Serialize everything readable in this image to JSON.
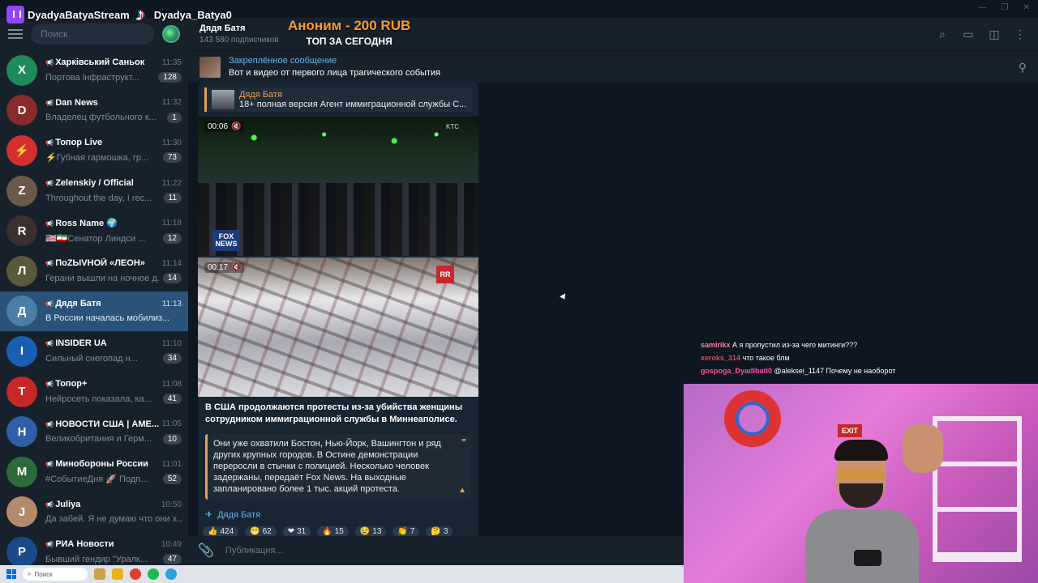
{
  "overlay": {
    "twitch_name": "DyadyaBatyaStream",
    "tiktok_name": "Dyadya_Batya0",
    "donation_line": "Аноним - 200 RUB",
    "donation_sub": "ТОП ЗА СЕГОДНЯ"
  },
  "sidebar": {
    "search_placeholder": "Поиск",
    "chats": [
      {
        "title": "Харківський Саньок",
        "time": "11:35",
        "preview": "Портова інфраструкт...",
        "badge": "128",
        "color": "#1f8a5a",
        "initial": "Х"
      },
      {
        "title": "Dan News",
        "time": "11:32",
        "preview": "Владелец футбольного к...",
        "badge": "1",
        "color": "#8a2b2b",
        "initial": "D"
      },
      {
        "title": "Топор Live",
        "time": "11:30",
        "preview": "⚡Губная гармошка, гр...",
        "badge": "73",
        "color": "#d32f2f",
        "initial": "⚡"
      },
      {
        "title": "Zelenskiy / Official",
        "time": "11:22",
        "preview": "Throughout the day, I rec...",
        "badge": "11",
        "color": "#6b5a4a",
        "initial": "Z"
      },
      {
        "title": "Ross Name 🌍",
        "time": "11:18",
        "preview": "🇺🇸🇮🇷Сенатор Линдси ...",
        "badge": "12",
        "color": "#3b3030",
        "initial": "R"
      },
      {
        "title": "ПоZЫVНОЙ «ЛЕОН»",
        "time": "11:14",
        "preview": "Герани вышли на ночное д...",
        "badge": "14",
        "color": "#5a5a3a",
        "initial": "Л"
      },
      {
        "title": "Дядя Батя",
        "time": "11:13",
        "preview": "В России началась мобилиз...",
        "badge": "",
        "color": "#4a7fa8",
        "initial": "Д"
      },
      {
        "title": "INSIDER UA",
        "time": "11:10",
        "preview": "Сильный снегопад н...",
        "badge": "34",
        "color": "#1a5fb4",
        "initial": "I"
      },
      {
        "title": "Топор+",
        "time": "11:08",
        "preview": "Нейросеть показала, ка...",
        "badge": "41",
        "color": "#c62828",
        "initial": "T"
      },
      {
        "title": "НОВОСТИ США | АМЕ...",
        "time": "11:05",
        "preview": "Великобритания и Герм...",
        "badge": "10",
        "color": "#2f5fa8",
        "initial": "Н"
      },
      {
        "title": "Минобороны России",
        "time": "11:01",
        "preview": "#СобытиеДня 🚀 Подп...",
        "badge": "52",
        "color": "#2e6b3a",
        "initial": "М"
      },
      {
        "title": "Juliya",
        "time": "10:50",
        "preview": "Да забей. Я не думаю что они х...",
        "badge": "",
        "color": "#b38a6a",
        "initial": "J"
      },
      {
        "title": "РИА Новости",
        "time": "10:49",
        "preview": "Бывший гендир \"Уралк...",
        "badge": "47",
        "color": "#1a4a8a",
        "initial": "Р"
      }
    ]
  },
  "channel": {
    "title": "Дядя Батя",
    "subscribers": "143 580 подписчиков"
  },
  "pinned": {
    "label": "Закреплённое сообщение",
    "text": "Вот и видео от первого лица трагического события"
  },
  "message": {
    "fwd_name": "Дядя Батя",
    "fwd_text": "18+ полная версия  Агент иммиграционной службы С...",
    "video1_time": "00:06",
    "video2_time": "00:17",
    "video1_logo": "FOX NEWS",
    "video1_tag": "KTC",
    "video2_logo": "RR",
    "text": "В США продолжаются протесты из-за убийства женщины сотрудником иммиграционной службы в Миннеаполисе.",
    "quote": "Они уже охватили Бостон, Нью-Йорк, Вашингтон и ряд других крупных городов. В Остине демонстрации переросли в стычки с полицией. Несколько человек задержаны, передаёт Fox News. На выходные запланировано более 1 тыс. акций протеста.",
    "signature": "Дядя Батя",
    "reactions": [
      {
        "emoji": "👍",
        "count": "424"
      },
      {
        "emoji": "😁",
        "count": "62"
      },
      {
        "emoji": "❤",
        "count": "31"
      },
      {
        "emoji": "🔥",
        "count": "15"
      },
      {
        "emoji": "😢",
        "count": "13"
      },
      {
        "emoji": "👏",
        "count": "7"
      },
      {
        "emoji": "🤔",
        "count": "3"
      }
    ]
  },
  "composer": {
    "placeholder": "Публикация..."
  },
  "stream_chat": [
    {
      "user": "samirikx",
      "color": "#ff7fa0",
      "text": "А я пропустил из-за чего митинги???"
    },
    {
      "user": "xeroks_314",
      "color": "#d0505a",
      "text": "что такое блм"
    },
    {
      "user": "gospoga_Dyadibati0",
      "color": "#ff4fa8",
      "text": "@aleksei_1147 Почему не наоборот"
    }
  ],
  "webcam": {
    "exit_sign": "EXIT"
  },
  "taskbar": {
    "search_label": "Поиск"
  }
}
